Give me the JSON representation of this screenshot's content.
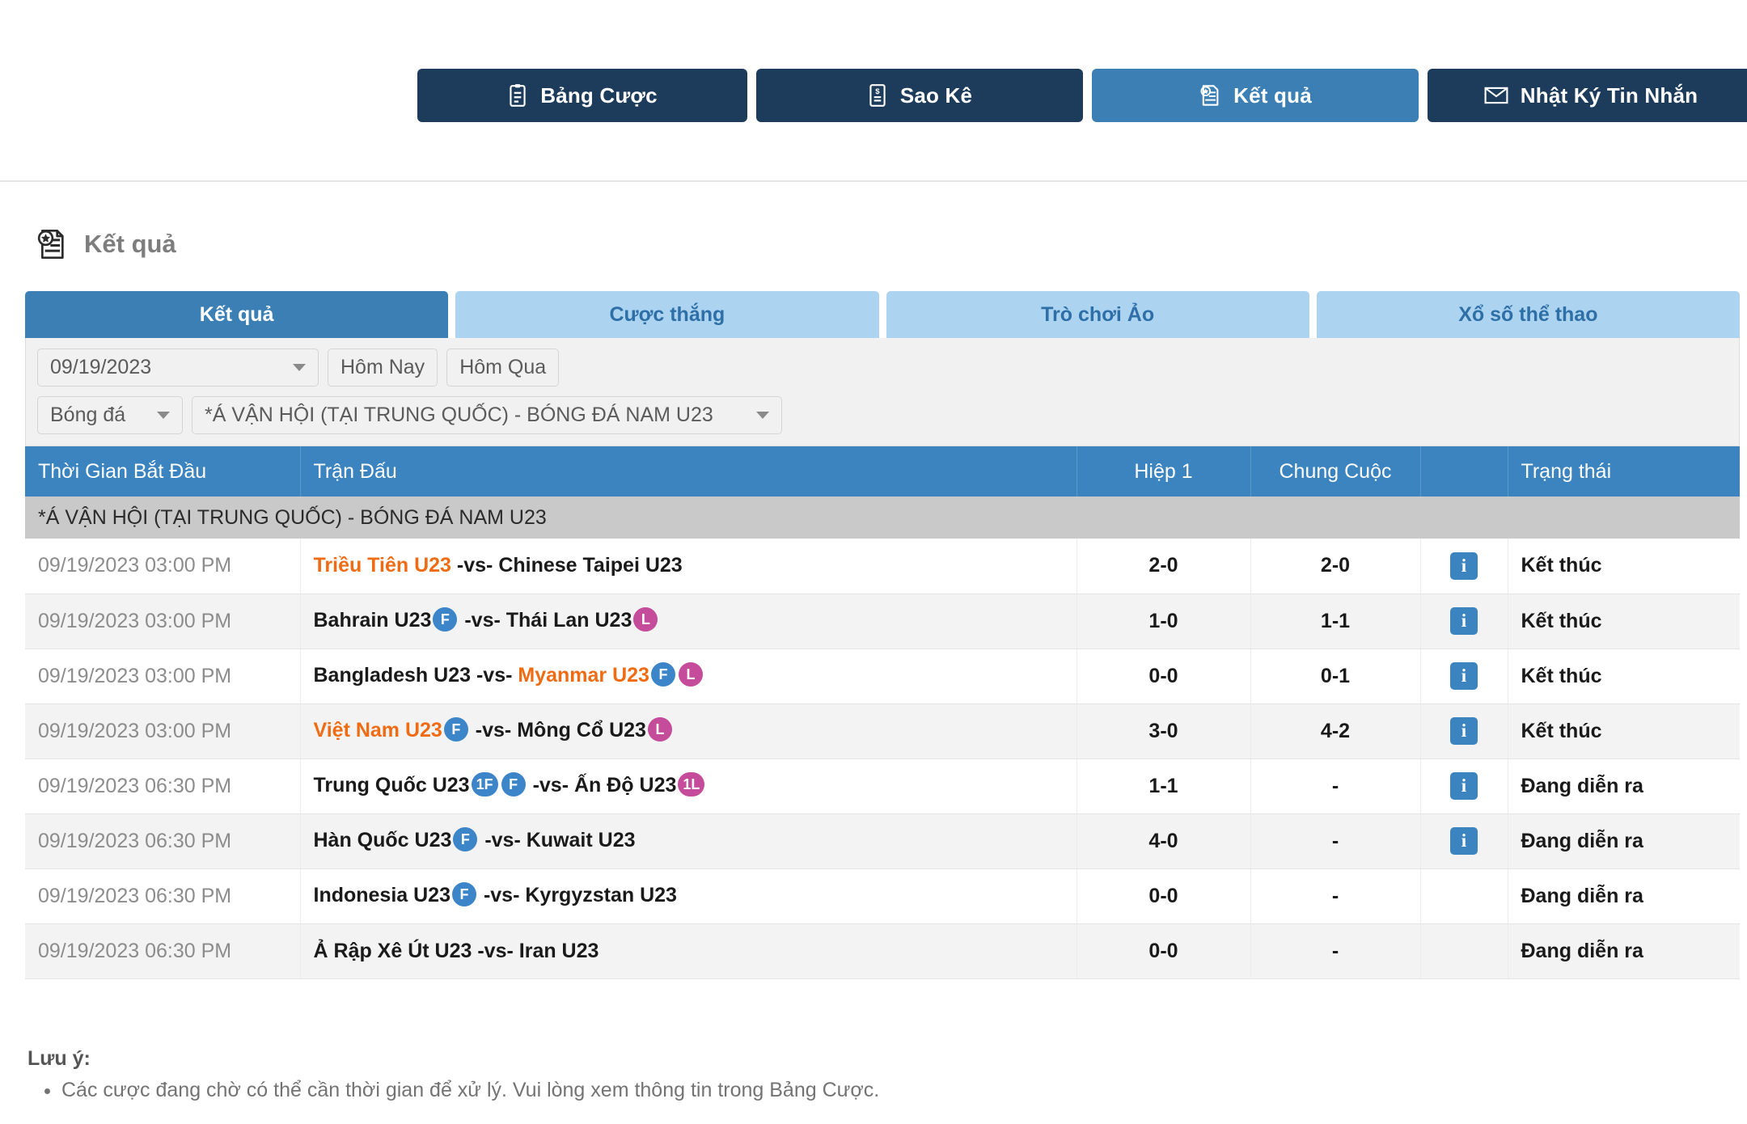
{
  "topnav": {
    "buttons": [
      {
        "label": "Bảng Cược",
        "icon": "clipboard-icon",
        "active": false
      },
      {
        "label": "Sao Kê",
        "icon": "statement-icon",
        "active": false
      },
      {
        "label": "Kết quả",
        "icon": "results-icon",
        "active": true
      },
      {
        "label": "Nhật Ký Tin Nhắn",
        "icon": "envelope-icon",
        "active": false
      }
    ]
  },
  "page": {
    "title": "Kết quả",
    "icon": "results-icon"
  },
  "tabs": [
    {
      "label": "Kết quả",
      "active": true
    },
    {
      "label": "Cược thắng",
      "active": false
    },
    {
      "label": "Trò chơi Ảo",
      "active": false
    },
    {
      "label": "Xổ số thể thao",
      "active": false
    }
  ],
  "filters": {
    "date_value": "09/19/2023",
    "today_label": "Hôm Nay",
    "yesterday_label": "Hôm Qua",
    "sport_value": "Bóng đá",
    "league_value": "*Á VẬN HỘI (TẠI TRUNG QUỐC) - BÓNG ĐÁ NAM U23"
  },
  "table": {
    "headers": {
      "time": "Thời Gian Bắt Đầu",
      "match": "Trận Đấu",
      "half1": "Hiệp 1",
      "fulltime": "Chung Cuộc",
      "info": "",
      "status": "Trạng thái"
    },
    "group_label": "*Á VẬN HỘI (TẠI TRUNG QUỐC) - BÓNG ĐÁ NAM U23",
    "vs_separator": "-vs-",
    "rows": [
      {
        "time": "09/19/2023 03:00 PM",
        "home": "Triều Tiên U23",
        "home_winner": true,
        "home_badges": [],
        "away": "Chinese Taipei U23",
        "away_winner": false,
        "away_badges": [],
        "half1": "2-0",
        "fulltime": "2-0",
        "has_info": true,
        "status": "Kết thúc"
      },
      {
        "time": "09/19/2023 03:00 PM",
        "home": "Bahrain U23",
        "home_winner": false,
        "home_badges": [
          "F"
        ],
        "away": "Thái Lan U23",
        "away_winner": false,
        "away_badges": [
          "L"
        ],
        "half1": "1-0",
        "fulltime": "1-1",
        "has_info": true,
        "status": "Kết thúc"
      },
      {
        "time": "09/19/2023 03:00 PM",
        "home": "Bangladesh U23",
        "home_winner": false,
        "home_badges": [],
        "away": "Myanmar U23",
        "away_winner": true,
        "away_badges": [
          "F",
          "L"
        ],
        "half1": "0-0",
        "fulltime": "0-1",
        "has_info": true,
        "status": "Kết thúc"
      },
      {
        "time": "09/19/2023 03:00 PM",
        "home": "Việt Nam U23",
        "home_winner": true,
        "home_badges": [
          "F"
        ],
        "away": "Mông Cổ U23",
        "away_winner": false,
        "away_badges": [
          "L"
        ],
        "half1": "3-0",
        "fulltime": "4-2",
        "has_info": true,
        "status": "Kết thúc"
      },
      {
        "time": "09/19/2023 06:30 PM",
        "home": "Trung Quốc U23",
        "home_winner": false,
        "home_badges": [
          "1F",
          "F"
        ],
        "away": "Ấn Độ U23",
        "away_winner": false,
        "away_badges": [
          "1L"
        ],
        "half1": "1-1",
        "fulltime": "-",
        "has_info": true,
        "status": "Đang diễn ra"
      },
      {
        "time": "09/19/2023 06:30 PM",
        "home": "Hàn Quốc U23",
        "home_winner": false,
        "home_badges": [
          "F"
        ],
        "away": "Kuwait U23",
        "away_winner": false,
        "away_badges": [],
        "half1": "4-0",
        "fulltime": "-",
        "has_info": true,
        "status": "Đang diễn ra"
      },
      {
        "time": "09/19/2023 06:30 PM",
        "home": "Indonesia U23",
        "home_winner": false,
        "home_badges": [
          "F"
        ],
        "away": "Kyrgyzstan U23",
        "away_winner": false,
        "away_badges": [],
        "half1": "0-0",
        "fulltime": "-",
        "has_info": false,
        "status": "Đang diễn ra"
      },
      {
        "time": "09/19/2023 06:30 PM",
        "home": "Ả Rập Xê Út U23",
        "home_winner": false,
        "home_badges": [],
        "away": "Iran U23",
        "away_winner": false,
        "away_badges": [],
        "half1": "0-0",
        "fulltime": "-",
        "has_info": false,
        "status": "Đang diễn ra"
      }
    ]
  },
  "note": {
    "title": "Lưu ý:",
    "items": [
      "Các cược đang chờ có thể cần thời gian để xử lý. Vui lòng xem thông tin trong Bảng Cược."
    ]
  },
  "colors": {
    "navy": "#1d3c5c",
    "accent_blue": "#3b7fb5",
    "tab_inactive_bg": "#acd4f0",
    "tab_inactive_text": "#2e6fa8",
    "table_header": "#3b84bf",
    "group_band": "#c9c9c9",
    "winner_orange": "#ef6c14",
    "badge_f": "#3b85c8",
    "badge_l": "#c44c9b"
  }
}
